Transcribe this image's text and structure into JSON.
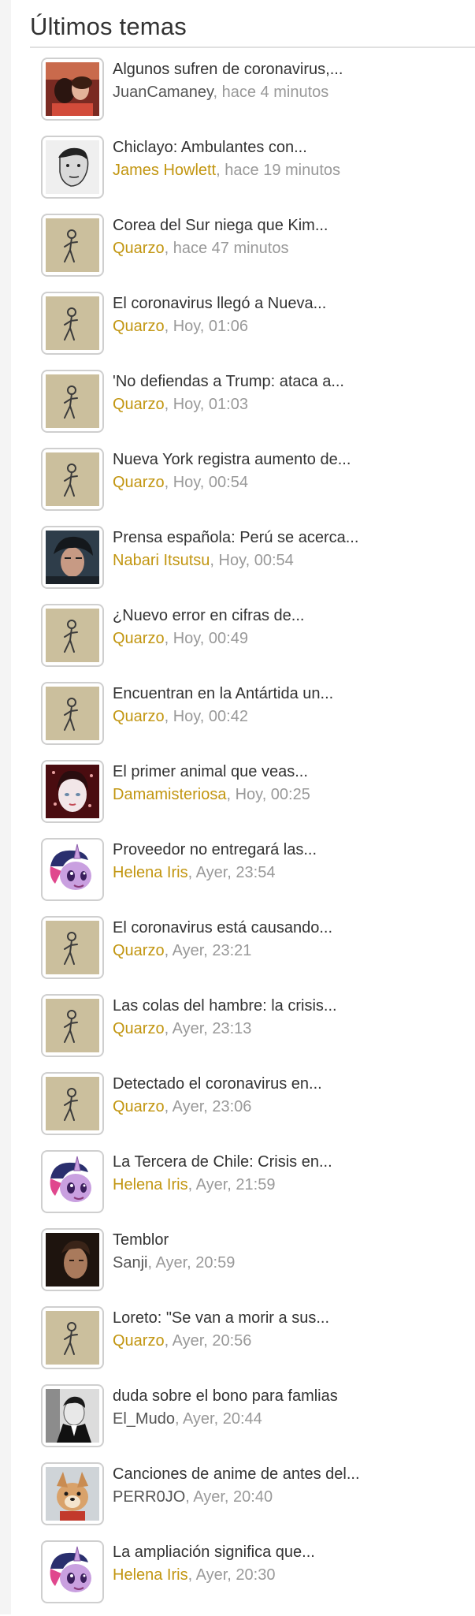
{
  "panel": {
    "title": "Últimos temas"
  },
  "colors": {
    "member_name": "#c29611",
    "plain_name": "#555555",
    "time": "#999999",
    "title_text": "#333333"
  },
  "topics": [
    {
      "title": "Algunos sufren de coronavirus,...",
      "author": "JuanCamaney",
      "author_style": "plain",
      "time": "hace 4 minutos",
      "avatar": "couple-photo-avatar"
    },
    {
      "title": "Chiclayo: Ambulantes con...",
      "author": "James Howlett",
      "author_style": "member",
      "time": "hace 19 minutos",
      "avatar": "sketch-portrait-avatar"
    },
    {
      "title": "Corea del Sur niega que Kim...",
      "author": "Quarzo",
      "author_style": "member",
      "time": "hace 47 minutos",
      "avatar": "stick-figure-avatar"
    },
    {
      "title": "El coronavirus llegó a Nueva...",
      "author": "Quarzo",
      "author_style": "member",
      "time": "Hoy, 01:06",
      "avatar": "stick-figure-avatar"
    },
    {
      "title": "'No defiendas a Trump: ataca a...",
      "author": "Quarzo",
      "author_style": "member",
      "time": "Hoy, 01:03",
      "avatar": "stick-figure-avatar"
    },
    {
      "title": "Nueva York registra aumento de...",
      "author": "Quarzo",
      "author_style": "member",
      "time": "Hoy, 00:54",
      "avatar": "stick-figure-avatar"
    },
    {
      "title": "Prensa española: Perú se acerca...",
      "author": "Nabari Itsutsu",
      "author_style": "member",
      "time": "Hoy, 00:54",
      "avatar": "anime-man-avatar"
    },
    {
      "title": "¿Nuevo error en cifras de...",
      "author": "Quarzo",
      "author_style": "member",
      "time": "Hoy, 00:49",
      "avatar": "stick-figure-avatar"
    },
    {
      "title": "Encuentran en la Antártida un...",
      "author": "Quarzo",
      "author_style": "member",
      "time": "Hoy, 00:42",
      "avatar": "stick-figure-avatar"
    },
    {
      "title": "El primer animal que veas...",
      "author": "Damamisteriosa",
      "author_style": "member",
      "time": "Hoy, 00:25",
      "avatar": "pale-woman-avatar"
    },
    {
      "title": "Proveedor no entregará las...",
      "author": "Helena Iris",
      "author_style": "member",
      "time": "Ayer, 23:54",
      "avatar": "purple-pony-avatar"
    },
    {
      "title": "El coronavirus está causando...",
      "author": "Quarzo",
      "author_style": "member",
      "time": "Ayer, 23:21",
      "avatar": "stick-figure-avatar"
    },
    {
      "title": "Las colas del hambre: la crisis...",
      "author": "Quarzo",
      "author_style": "member",
      "time": "Ayer, 23:13",
      "avatar": "stick-figure-avatar"
    },
    {
      "title": "Detectado el coronavirus en...",
      "author": "Quarzo",
      "author_style": "member",
      "time": "Ayer, 23:06",
      "avatar": "stick-figure-avatar"
    },
    {
      "title": "La Tercera de Chile: Crisis en...",
      "author": "Helena Iris",
      "author_style": "member",
      "time": "Ayer, 21:59",
      "avatar": "purple-pony-avatar"
    },
    {
      "title": "Temblor",
      "author": "Sanji",
      "author_style": "plain",
      "time": "Ayer, 20:59",
      "avatar": "dark-portrait-avatar"
    },
    {
      "title": "Loreto: \"Se van a morir a sus...",
      "author": "Quarzo",
      "author_style": "member",
      "time": "Ayer, 20:56",
      "avatar": "stick-figure-avatar"
    },
    {
      "title": "duda sobre el bono para famlias",
      "author": "El_Mudo",
      "author_style": "plain",
      "time": "Ayer, 20:44",
      "avatar": "bw-portrait-avatar"
    },
    {
      "title": "Canciones de anime de antes del...",
      "author": "PERR0JO",
      "author_style": "plain",
      "time": "Ayer, 20:40",
      "avatar": "dog-photo-avatar"
    },
    {
      "title": "La ampliación significa que...",
      "author": "Helena Iris",
      "author_style": "member",
      "time": "Ayer, 20:30",
      "avatar": "purple-pony-avatar"
    }
  ]
}
